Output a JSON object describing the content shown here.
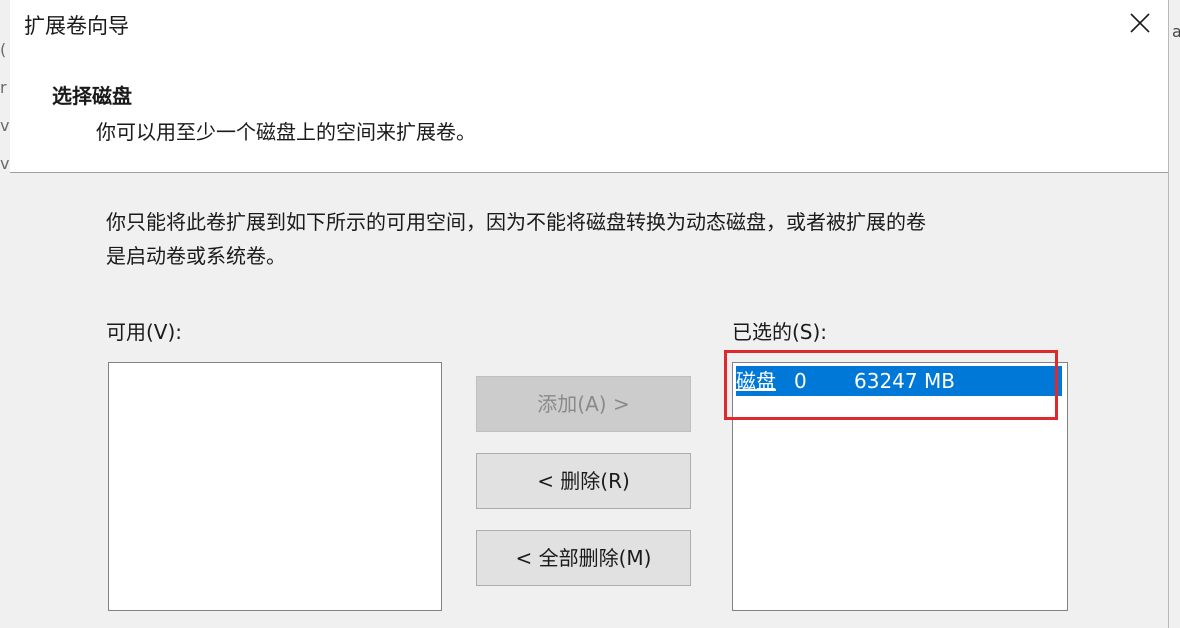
{
  "window": {
    "title": "扩展卷向导",
    "close_icon": "close-icon"
  },
  "header": {
    "title": "选择磁盘",
    "subtitle": "你可以用至少一个磁盘上的空间来扩展卷。"
  },
  "content": {
    "description_line1": "你只能将此卷扩展到如下所示的可用空间，因为不能将磁盘转换为动态磁盘，或者被扩展的卷",
    "description_line2": "是启动卷或系统卷。",
    "available_label": "可用(V):",
    "selected_label": "已选的(S):",
    "available_items": [],
    "selected_items": [
      {
        "name": "磁盘",
        "number": "0",
        "size": "63247 MB",
        "selected": true
      }
    ]
  },
  "buttons": {
    "add_label": "添加(A) >",
    "add_enabled": false,
    "remove_label": "< 删除(R)",
    "remove_all_label": "< 全部删除(M)"
  },
  "colors": {
    "selection": "#0078d7",
    "highlight_box": "#e0292e",
    "content_bg": "#f0f0f0"
  }
}
